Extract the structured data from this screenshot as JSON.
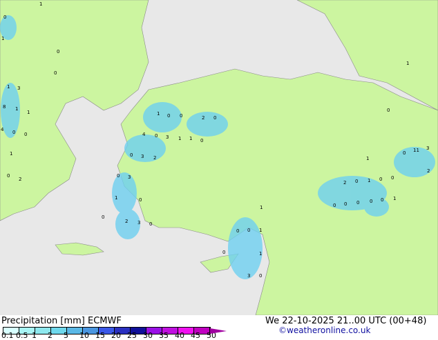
{
  "title": "Precipitation [mm]",
  "model": "ECMWF",
  "datetime": "We 22-10-2025 21..00 UTC (00+48)",
  "credit": "©weatheronline.co.uk",
  "legend": {
    "ticks": [
      "0.1",
      "0.5",
      "1",
      "2",
      "5",
      "10",
      "15",
      "20",
      "25",
      "30",
      "35",
      "40",
      "45",
      "50"
    ],
    "colors": [
      "#d7ffff",
      "#a8f5f5",
      "#8ee8ee",
      "#6ed8ec",
      "#5ab8e6",
      "#4a96e0",
      "#3a58e8",
      "#2a30c0",
      "#10109a",
      "#9a10e6",
      "#c010e0",
      "#f010f0",
      "#c000c0"
    ]
  },
  "colors": {
    "land": "#ccf5a0",
    "sea": "#e8e8e8",
    "rain": "#6ed0f0"
  },
  "map_labels": [
    "1",
    "0",
    "1",
    "0",
    "0",
    "1",
    "3",
    "8",
    "1",
    "1",
    "4",
    "0",
    "0",
    "1",
    "0",
    "2",
    "1",
    "0",
    "0",
    "2",
    "0",
    "4",
    "0",
    "3",
    "1",
    "1",
    "0",
    "0",
    "3",
    "2",
    "0",
    "3",
    "1",
    "0",
    "2",
    "3",
    "0",
    "0",
    "0",
    "0",
    "1",
    "1",
    "0",
    "1",
    "3",
    "0",
    "2",
    "0",
    "1",
    "0",
    "0",
    "1",
    "0",
    "11",
    "0",
    "0",
    "0",
    "0",
    "0",
    "1",
    "3",
    "2",
    "1",
    "0"
  ]
}
